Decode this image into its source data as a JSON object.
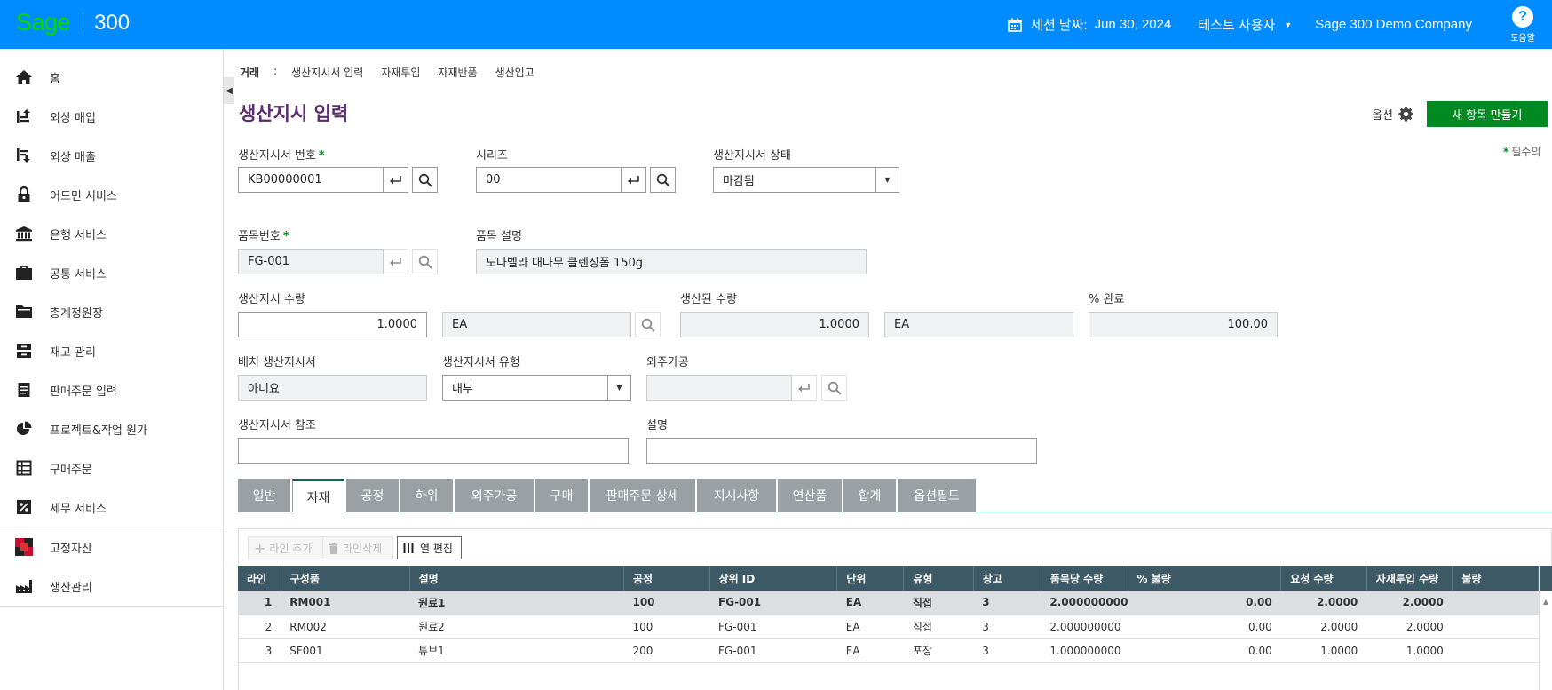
{
  "header": {
    "logo_brand": "Sage",
    "logo_product": "300",
    "session_label": "세션 날짜:",
    "session_date": "Jun 30, 2024",
    "user": "테스트 사용자",
    "company": "Sage 300 Demo Company",
    "help_label": "도움말",
    "help_icon": "?"
  },
  "sidebar": {
    "items": [
      {
        "label": "홈",
        "icon": "home-icon"
      },
      {
        "label": "외상 매입",
        "icon": "payables-icon"
      },
      {
        "label": "외상 매출",
        "icon": "receivables-icon"
      },
      {
        "label": "어드민 서비스",
        "icon": "lock-icon"
      },
      {
        "label": "은행 서비스",
        "icon": "bank-icon"
      },
      {
        "label": "공통 서비스",
        "icon": "briefcase-icon"
      },
      {
        "label": "총계정원장",
        "icon": "folder-icon"
      },
      {
        "label": "재고 관리",
        "icon": "inventory-icon"
      },
      {
        "label": "판매주문 입력",
        "icon": "document-icon"
      },
      {
        "label": "프로젝트&작업 원가",
        "icon": "pie-chart-icon"
      },
      {
        "label": "구매주문",
        "icon": "table-icon"
      },
      {
        "label": "세무 서비스",
        "icon": "percent-icon"
      },
      {
        "label": "고정자산",
        "icon": "fixed-assets-icon"
      },
      {
        "label": "생산관리",
        "icon": "factory-icon"
      }
    ]
  },
  "breadcrumb": {
    "root": "거래",
    "sep": ":",
    "links": [
      "생산지시서 입력",
      "자재투입",
      "자재반품",
      "생산입고"
    ]
  },
  "page": {
    "title": "생산지시 입력",
    "options_label": "옵션",
    "new_button": "새 항목 만들기",
    "required_note": "필수의"
  },
  "form": {
    "order_no_label": "생산지시서 번호",
    "order_no": "KB00000001",
    "series_label": "시리즈",
    "series": "00",
    "status_label": "생산지시서 상태",
    "status": "마감됨",
    "item_no_label": "품목번호",
    "item_no": "FG-001",
    "item_desc_label": "품목 설명",
    "item_desc": "도나벨라 대나무 클렌징폼 150g",
    "order_qty_label": "생산지시 수량",
    "order_qty": "1.0000",
    "order_uom": "EA",
    "produced_qty_label": "생산된 수량",
    "produced_qty": "1.0000",
    "produced_uom": "EA",
    "pct_label": "% 완료",
    "pct": "100.00",
    "batch_label": "배치 생산지시서",
    "batch": "아니요",
    "type_label": "생산지시서 유형",
    "type": "내부",
    "subcontract_label": "외주가공",
    "subcontract": "",
    "reference_label": "생산지시서 참조",
    "reference": "",
    "description_label": "설명",
    "description": ""
  },
  "tabs": [
    "일반",
    "자재",
    "공정",
    "하위",
    "외주가공",
    "구매",
    "판매주문 상세",
    "지시사항",
    "연산품",
    "합계",
    "옵션필드"
  ],
  "active_tab": "자재",
  "toolbar": {
    "add_line": "라인 추가",
    "delete_line": "라인삭제",
    "edit_columns": "열 편집"
  },
  "grid": {
    "columns": [
      "라인",
      "구성품",
      "설명",
      "공정",
      "상위 ID",
      "단위",
      "유형",
      "창고",
      "품목당 수량",
      "% 불량",
      "요청 수량",
      "자재투입 수량",
      "불량"
    ],
    "rows": [
      [
        "1",
        "RM001",
        "원료1",
        "100",
        "FG-001",
        "EA",
        "직접",
        "3",
        "2.000000000",
        "0.00",
        "2.0000",
        "2.0000",
        ""
      ],
      [
        "2",
        "RM002",
        "원료2",
        "100",
        "FG-001",
        "EA",
        "직접",
        "3",
        "2.000000000",
        "0.00",
        "2.0000",
        "2.0000",
        ""
      ],
      [
        "3",
        "SF001",
        "튜브1",
        "200",
        "FG-001",
        "EA",
        "포장",
        "3",
        "1.000000000",
        "0.00",
        "1.0000",
        "1.0000",
        ""
      ]
    ]
  },
  "colors": {
    "topbar": "#008CFF",
    "brand_green": "#00DC00",
    "title_purple": "#5B2C6F",
    "primary_button": "#008A21",
    "grid_header": "#3d5966",
    "tab_inactive": "#9aa0a3"
  }
}
